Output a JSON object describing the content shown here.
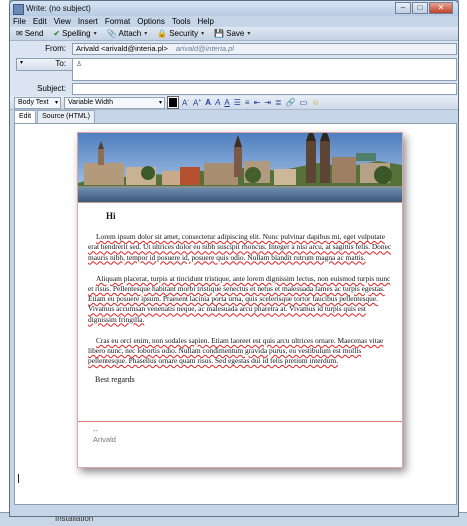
{
  "window": {
    "title": "Write: (no subject)"
  },
  "menu": [
    "File",
    "Edit",
    "View",
    "Insert",
    "Format",
    "Options",
    "Tools",
    "Help"
  ],
  "toolbar": [
    {
      "label": "Send",
      "icon": "send-icon",
      "dropdown": false
    },
    {
      "label": "Spelling",
      "icon": "spellcheck-icon",
      "dropdown": true
    },
    {
      "label": "Attach",
      "icon": "paperclip-icon",
      "dropdown": true
    },
    {
      "label": "Security",
      "icon": "lock-icon",
      "dropdown": true
    },
    {
      "label": "Save",
      "icon": "save-icon",
      "dropdown": true
    }
  ],
  "header": {
    "from_label": "From:",
    "from_value": "Arivald <arivald@interia.pl>",
    "from_hint": "arivald@interia.pl",
    "to_label": "To:",
    "subject_label": "Subject:",
    "subject_value": ""
  },
  "format": {
    "paragraph": "Body Text",
    "font": "Variable Width"
  },
  "tabs": [
    "Edit",
    "Source (HTML)"
  ],
  "message": {
    "greeting": "Hi",
    "p1": "Lorem ipsum dolor sit amet, consectetur adipiscing elit. Nunc pulvinar dapibus mi, eget vulputate erat hendrerit sed. Ut ultrices dolor eu nibh suscipit rhoncus. Integer a nisi arcu, at sagittis felis. Donec mauris nibh, tempor id posuere id, posuere quis odio. Nullam blandit rutrum magna ac mattis.",
    "p2": "Aliquam placerat, turpis at tincidunt tristique, ante lorem dignissim lectus, non euismod turpis nunc et risus. Pellentesque habitant morbi tristique senectus et netus et malesuada fames ac turpis egestas. Etiam eu posuere ipsum. Praesent lacinia porta urna, quis scelerisque tortor faucibus pellentesque. Vivamus accumsan venenatis neque, ac malesuada arcu pharetra at. Vivamus id turpis quis est dignissim fringilla.",
    "p3": "Cras eu orci enim, non sodales sapien. Etiam laoreet est quis arcu ultrices ornare. Maecenas vitae libero nunc, nec lobortis odio. Nullam condimentum gravida purus, eu vestibulum est mollis pellentesque. Phasellus ornare quam risus. Sed egestas dui id felis pretium interdum.",
    "closing": "Best regards",
    "sig_sep": "--",
    "sig_name": "Arivald"
  },
  "taskbar": {
    "item": "Installation"
  },
  "colors": {
    "accent": "#c6d5e8",
    "banner_sky": "#7fa7d4",
    "signature_rule": "#d77777"
  }
}
